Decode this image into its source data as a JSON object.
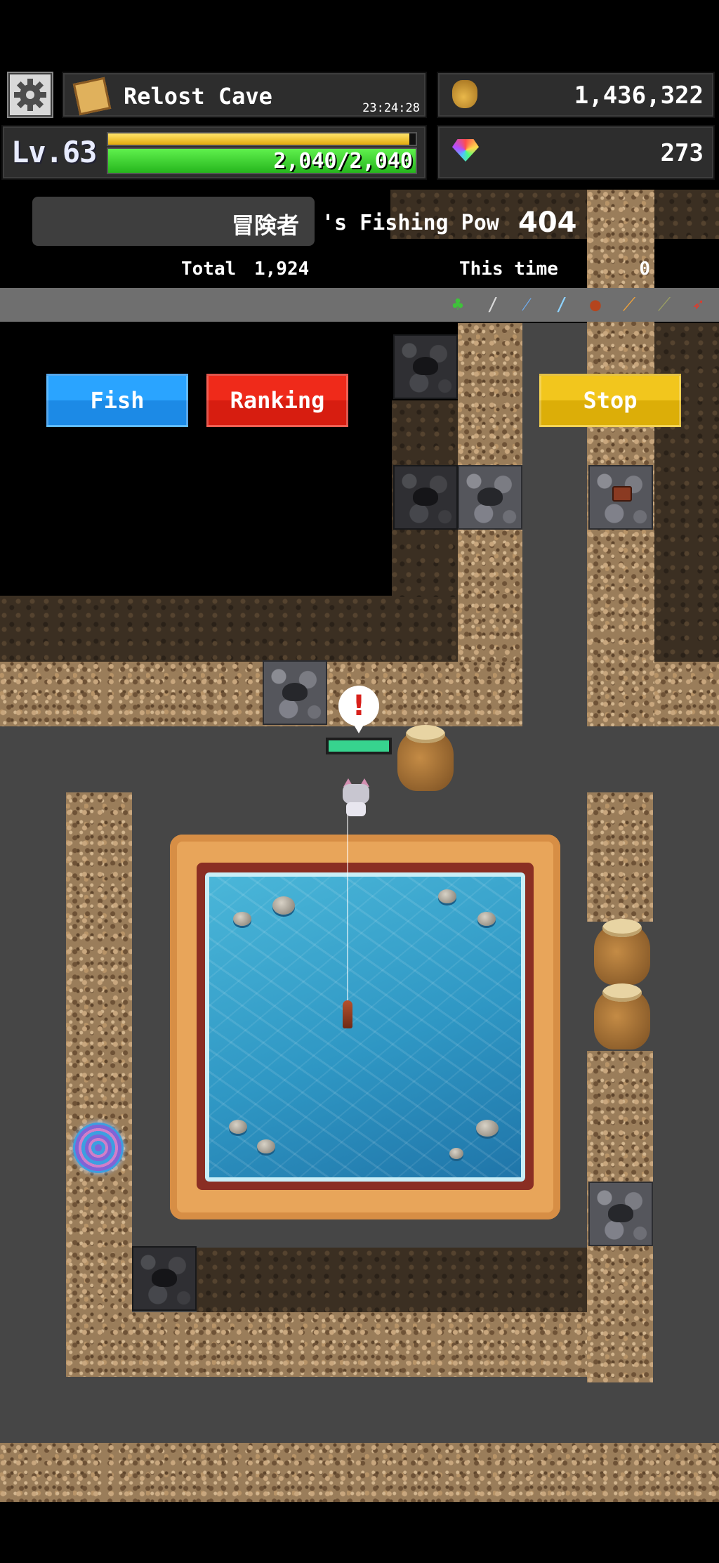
{
  "location": {
    "name": "Relost Cave",
    "clock": "23:24:28"
  },
  "gold": "1,436,322",
  "gems": "273",
  "level": {
    "label": "Lv.63",
    "hp_text": "2,040/2,040",
    "exp_fraction": 0.98,
    "hp_fraction": 1.0
  },
  "fishing": {
    "player_name": "冒険者",
    "pow_label": "'s Fishing Pow",
    "pow_value": "404",
    "total_label": "Total",
    "total_value": "1,924",
    "this_time_label": "This time",
    "this_time_value": "0"
  },
  "buttons": {
    "fish": "Fish",
    "ranking": "Ranking",
    "stop": "Stop"
  },
  "item_bar": [
    "clover-icon",
    "sword-icon",
    "blue-fish-icon",
    "blue-blade-icon",
    "meat-icon",
    "torch-icon",
    "bone-fish-icon",
    "shrimp-icon"
  ],
  "colors": {
    "exp_bar": "#f2c21d",
    "hp_bar": "#36d636",
    "fish_button": "#2aa4ff",
    "ranking_button": "#ef2a1a",
    "stop_button": "#f2c61d"
  }
}
